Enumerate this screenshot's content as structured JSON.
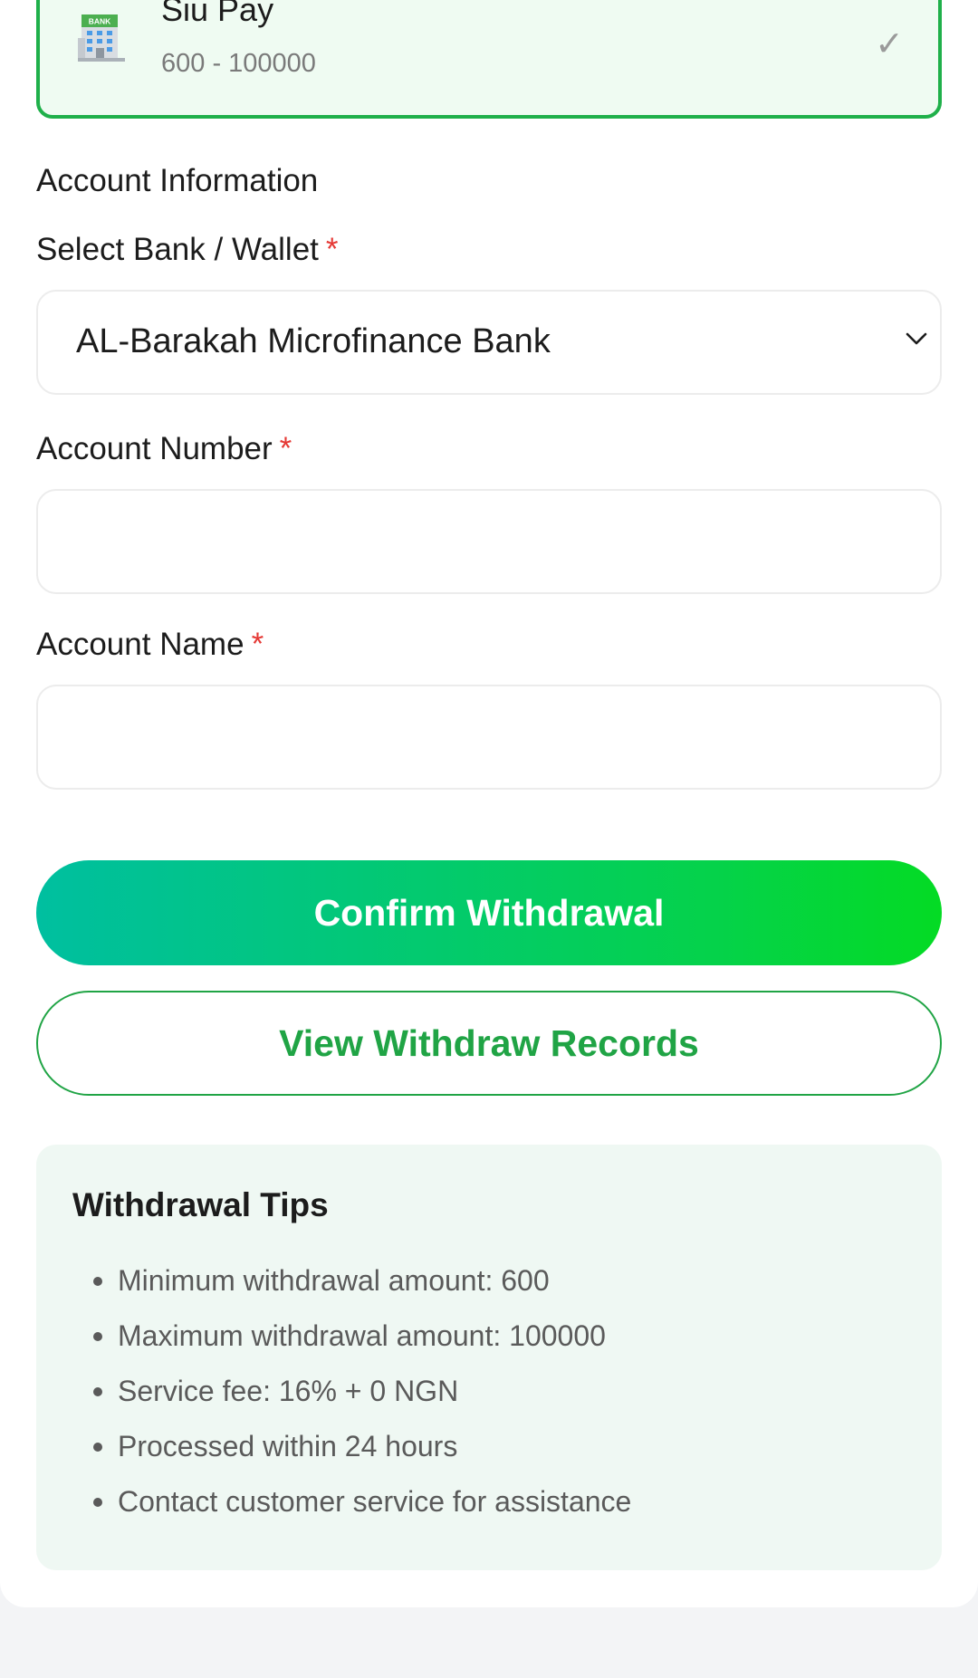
{
  "payment_method": {
    "name": "Siu Pay",
    "range": "600 - 100000",
    "icon": "bank-building-icon",
    "icon_badge": "BANK",
    "selected": true,
    "check_glyph": "✓"
  },
  "account_info": {
    "section_title": "Account Information",
    "bank_label": "Select Bank / Wallet",
    "bank_value": "AL-Barakah Microfinance Bank",
    "account_number_label": "Account Number",
    "account_number_value": "",
    "account_name_label": "Account Name",
    "account_name_value": "",
    "required_mark": "*"
  },
  "actions": {
    "confirm_label": "Confirm Withdrawal",
    "records_label": "View Withdraw Records"
  },
  "tips": {
    "title": "Withdrawal Tips",
    "items": [
      "Minimum withdrawal amount: 600",
      "Maximum withdrawal amount: 100000",
      "Service fee: 16% + 0 NGN",
      "Processed within 24 hours",
      "Contact customer service for assistance"
    ]
  },
  "colors": {
    "accent_green": "#20a445",
    "gradient_start": "#00bfa0",
    "gradient_end": "#04db24",
    "required_red": "#e53935",
    "tips_background": "#eff8f3"
  }
}
